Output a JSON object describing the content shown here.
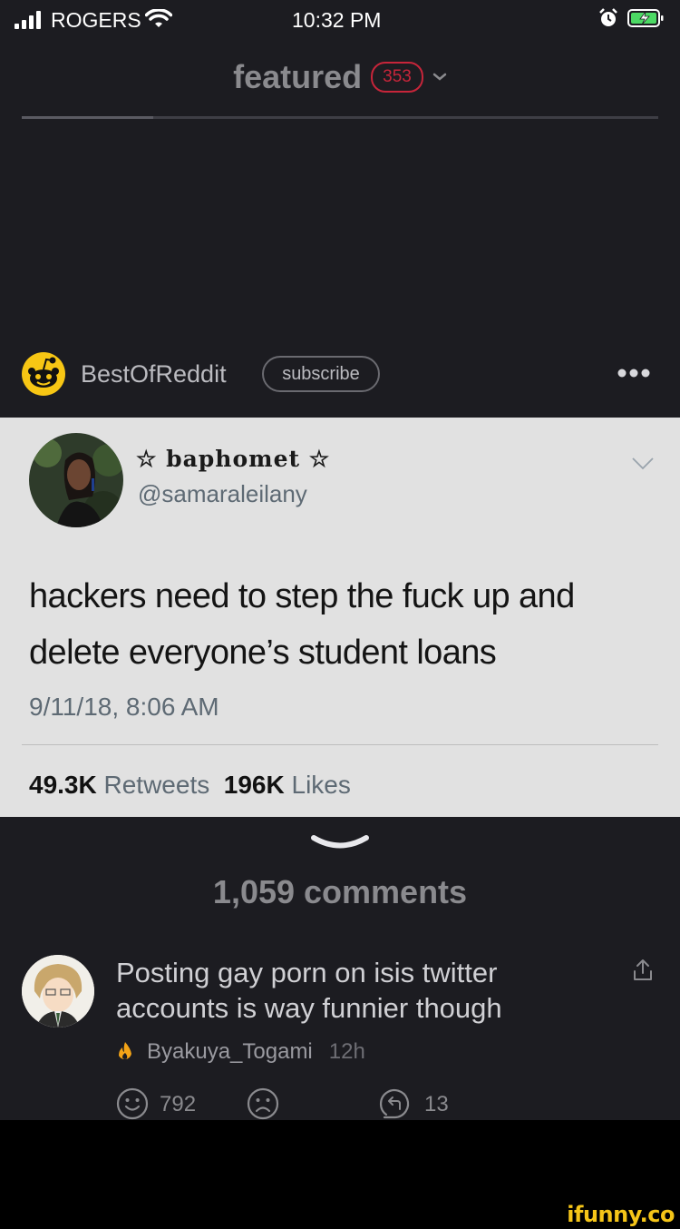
{
  "status_bar": {
    "carrier": "ROGERS",
    "time": "10:32 PM"
  },
  "feed": {
    "title": "featured",
    "count": "353"
  },
  "channel": {
    "name": "BestOfReddit",
    "subscribe_label": "subscribe"
  },
  "tweet": {
    "display_name": "☆ baphomet ☆",
    "handle": "@samaraleilany",
    "text": "hackers need to step the fuck up and delete everyone’s student loans",
    "timestamp": "9/11/18, 8:06 AM",
    "retweets_value": "49.3K",
    "retweets_label": "Retweets",
    "likes_value": "196K",
    "likes_label": "Likes"
  },
  "comments": {
    "count_label": "1,059 comments",
    "items": [
      {
        "text": "Posting gay porn on isis twitter accounts is way funnier though",
        "author": "Byakuya_Togami",
        "time": "12h",
        "smiles": "792",
        "replies": "13"
      }
    ]
  },
  "watermark": "ifunny.co",
  "colors": {
    "background": "#1c1c21",
    "tweet_card": "#e1e1e1",
    "badge_red": "#c7253a",
    "reddit_logo": "#f7c614"
  }
}
